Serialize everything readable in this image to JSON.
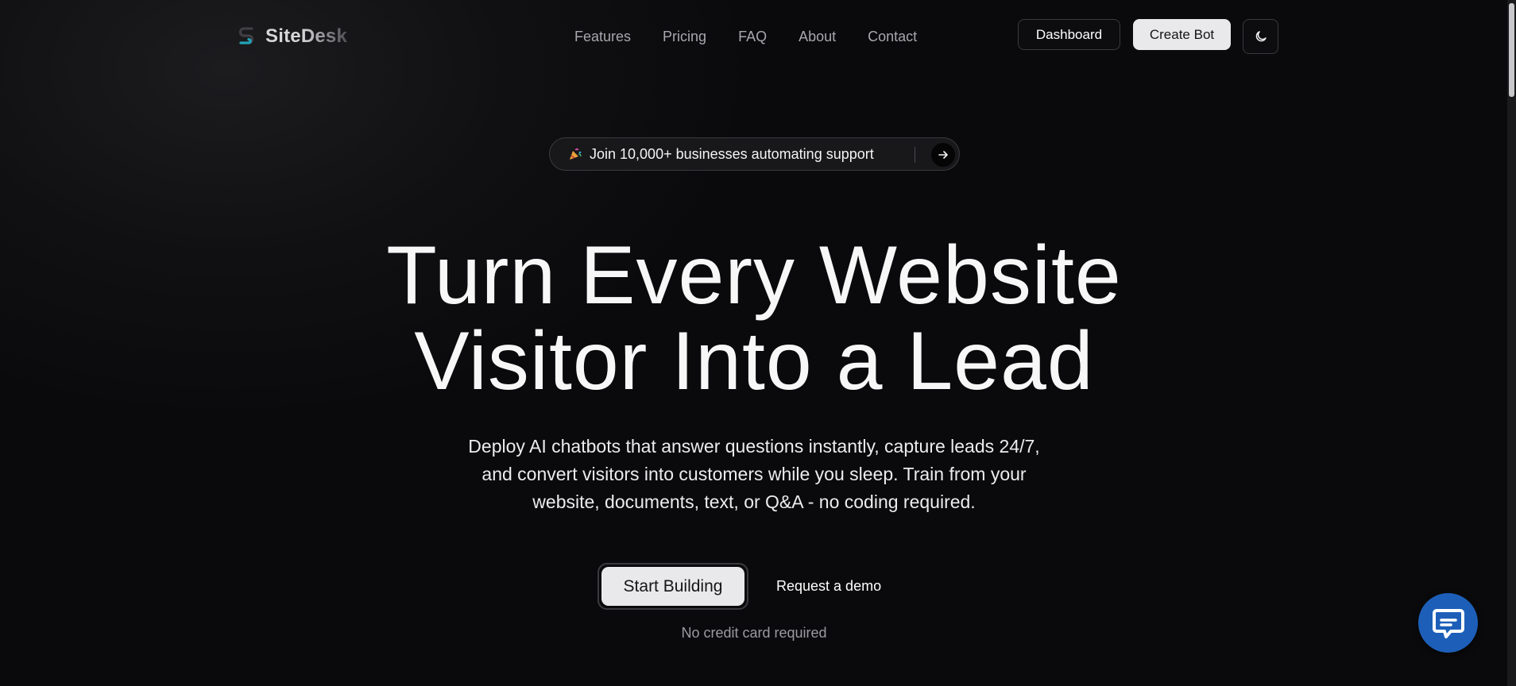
{
  "brand": {
    "name": "SiteDesk",
    "logo_icon": "sitedesk-s-logo"
  },
  "nav": {
    "links": [
      "Features",
      "Pricing",
      "FAQ",
      "About",
      "Contact"
    ],
    "dashboard_label": "Dashboard",
    "create_bot_label": "Create Bot",
    "theme_toggle_icon": "moon-icon"
  },
  "announcement": {
    "emoji_icon": "party-popper-icon",
    "text": "Join 10,000+ businesses automating support",
    "arrow_icon": "arrow-right-icon"
  },
  "hero": {
    "headline_line1": "Turn Every Website",
    "headline_line2": "Visitor Into a Lead",
    "subtitle": "Deploy AI chatbots that answer questions instantly, capture leads 24/7, and convert visitors into customers while you sleep. Train from your website, documents, text, or Q&A - no coding required.",
    "primary_cta": "Start Building",
    "secondary_cta": "Request a demo",
    "note": "No credit card required"
  },
  "chat_widget": {
    "icon": "chat-support-icon",
    "color": "#1d5fb8"
  },
  "colors": {
    "background": "#0a0a0c",
    "accent": "#1d5fb8",
    "logo_teal": "#1fa3b8",
    "button_light": "#e9e9ec"
  }
}
